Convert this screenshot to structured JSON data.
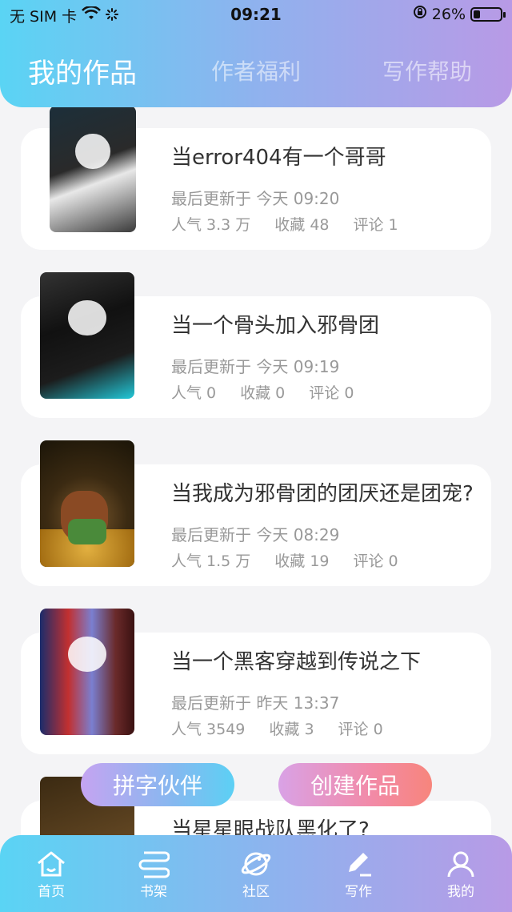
{
  "status_bar": {
    "carrier": "无 SIM 卡",
    "time": "09:21",
    "battery_text": "26%",
    "battery_level": 0.26
  },
  "tabs": [
    {
      "label": "我的作品",
      "active": true
    },
    {
      "label": "作者福利",
      "active": false
    },
    {
      "label": "写作帮助",
      "active": false
    }
  ],
  "works": [
    {
      "title": "当error404有一个哥哥",
      "updated": "最后更新于 今天 09:20",
      "popularity": "人气 3.3 万",
      "favorites": "收藏 48",
      "comments": "评论 1"
    },
    {
      "title": "当一个骨头加入邪骨团",
      "updated": "最后更新于 今天 09:19",
      "popularity": "人气 0",
      "favorites": "收藏 0",
      "comments": "评论 0"
    },
    {
      "title": "当我成为邪骨团的团厌还是团宠?",
      "updated": "最后更新于 今天 08:29",
      "popularity": "人气 1.5 万",
      "favorites": "收藏 19",
      "comments": "评论 0"
    },
    {
      "title": "当一个黑客穿越到传说之下",
      "updated": "最后更新于 昨天 13:37",
      "popularity": "人气 3549",
      "favorites": "收藏 3",
      "comments": "评论 0"
    },
    {
      "title": "当星星眼战队黑化了?"
    }
  ],
  "buttons": {
    "partner": "拼字伙伴",
    "create": "创建作品"
  },
  "bottom_nav": [
    {
      "label": "首页",
      "icon": "home-icon"
    },
    {
      "label": "书架",
      "icon": "bookshelf-icon"
    },
    {
      "label": "社区",
      "icon": "planet-icon"
    },
    {
      "label": "写作",
      "icon": "pen-icon",
      "active": true
    },
    {
      "label": "我的",
      "icon": "user-icon"
    }
  ],
  "colors": {
    "gradient_start": "#5ad4f4",
    "gradient_end": "#b89ae6",
    "create_button": "#f28aa8"
  }
}
